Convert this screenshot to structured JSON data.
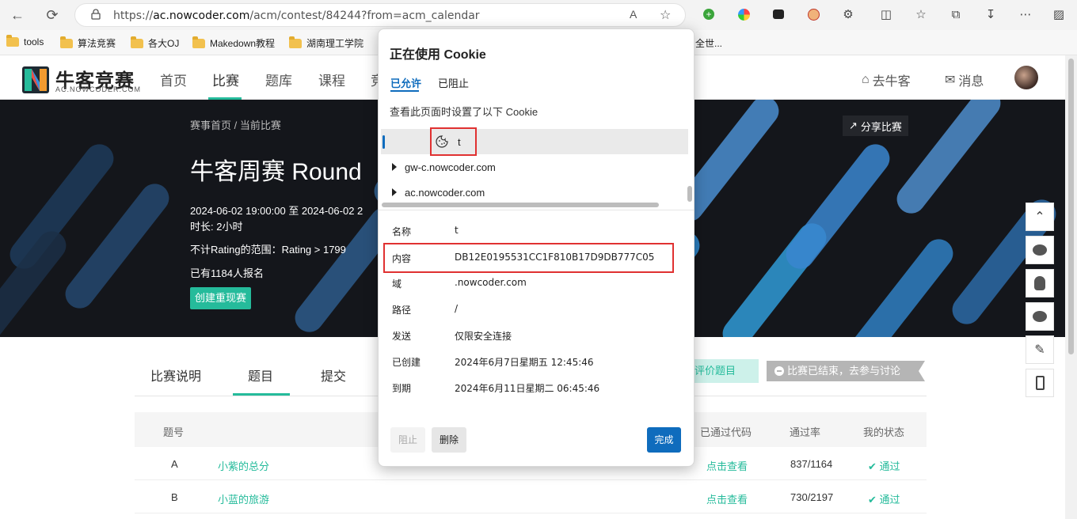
{
  "browser": {
    "url_scheme": "https://",
    "url_host": "ac.nowcoder.com",
    "url_path": "/acm/contest/84244?from=acm_calendar",
    "read_aloud_label": "A",
    "bookmarks": [
      "tools",
      "算法竞赛",
      "各大OJ",
      "Makedown教程",
      "湖南理工学院"
    ],
    "bookmark_overflow": "全世..."
  },
  "site": {
    "logo_text": "牛客竞赛",
    "logo_sub": "AC.NOWCODER.COM",
    "nav": [
      "首页",
      "比赛",
      "题库",
      "课程",
      "竞"
    ],
    "go_nowcoder": "去牛客",
    "messages": "消息"
  },
  "banner": {
    "breadcrumb": "赛事首页 / 当前比赛",
    "title": "牛客周赛 Round",
    "time": "2024-06-02 19:00:00 至 2024-06-02 2",
    "duration": "时长: 2小时",
    "rating": "不计Rating的范围：Rating > 1799",
    "registered": "已有1184人报名",
    "replay_button": "创建重现赛",
    "share": "分享比赛"
  },
  "tabs": {
    "items": [
      "比赛说明",
      "题目",
      "提交"
    ],
    "rate_button": "评价题目",
    "ended_badge": "比赛已结束，去参与讨论"
  },
  "table": {
    "headers": {
      "id": "题号",
      "code": "已通过代码",
      "rate": "通过率",
      "status": "我的状态"
    },
    "rows": [
      {
        "id": "A",
        "title": "小紫的总分",
        "code": "点击查看",
        "rate": "837/1164",
        "status": "通过"
      },
      {
        "id": "B",
        "title": "小蓝的旅游",
        "code": "点击查看",
        "rate": "730/2197",
        "status": "通过"
      }
    ]
  },
  "popup": {
    "title": "正在使用 Cookie",
    "tab_allowed": "已允许",
    "tab_blocked": "已阻止",
    "description": "查看此页面时设置了以下 Cookie",
    "tree": [
      {
        "label": "t",
        "selected": true
      },
      {
        "label": "gw-c.nowcoder.com",
        "selected": false
      },
      {
        "label": "ac.nowcoder.com",
        "selected": false
      }
    ],
    "props": [
      {
        "label": "名称",
        "value": "t"
      },
      {
        "label": "内容",
        "value": "DB12E0195531CC1F810B17D9DB777C05"
      },
      {
        "label": "域",
        "value": ".nowcoder.com"
      },
      {
        "label": "路径",
        "value": "/"
      },
      {
        "label": "发送",
        "value": "仅限安全连接"
      },
      {
        "label": "已创建",
        "value": "2024年6月7日星期五 12:45:46"
      },
      {
        "label": "到期",
        "value": "2024年6月11日星期二 06:45:46"
      }
    ],
    "block_button": "阻止",
    "delete_button": "删除",
    "done_button": "完成"
  },
  "colors": {
    "accent": "#25bb9b",
    "edge_blue": "#0f6cbd",
    "highlight_red": "#e03131"
  }
}
